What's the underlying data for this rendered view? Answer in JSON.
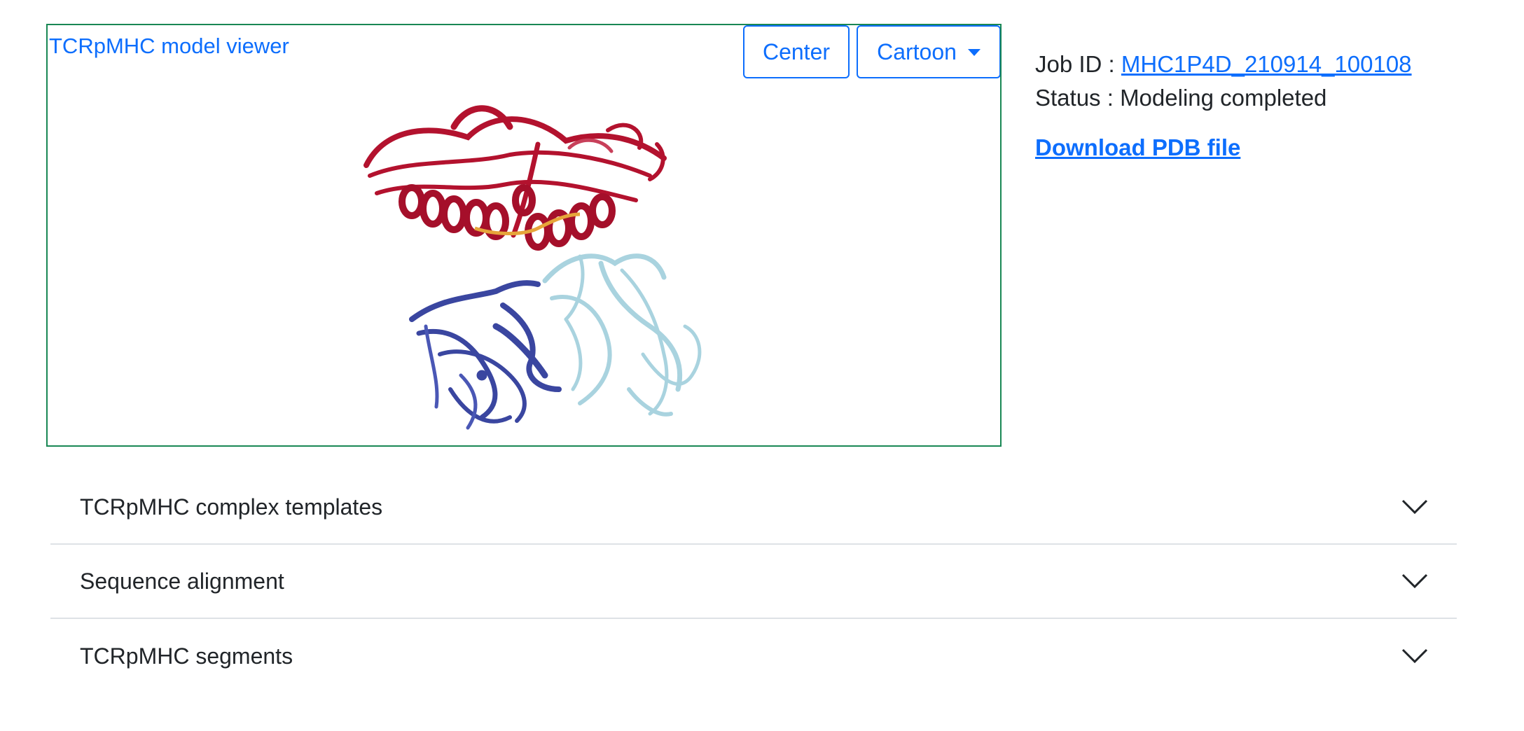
{
  "viewer": {
    "title": "TCRpMHC model viewer",
    "center_label": "Center",
    "style_label": "Cartoon"
  },
  "job": {
    "id_label": "Job ID : ",
    "id_value": "MHC1P4D_210914_100108",
    "status_label": "Status : ",
    "status_value": "Modeling completed",
    "download_label": "Download PDB file"
  },
  "accordion": {
    "items": [
      {
        "label": "TCRpMHC complex templates"
      },
      {
        "label": "Sequence alignment"
      },
      {
        "label": "TCRpMHC segments"
      }
    ]
  },
  "colors": {
    "mhc": "#b3122e",
    "tcr_alpha": "#3a46a0",
    "tcr_beta": "#a9d3df",
    "peptide": "#e6a53a",
    "accent": "#0d6efd",
    "viewer_border": "#198754"
  },
  "icons": {
    "accordion_toggle": "chevron-down-icon",
    "dropdown": "caret-down-icon"
  }
}
